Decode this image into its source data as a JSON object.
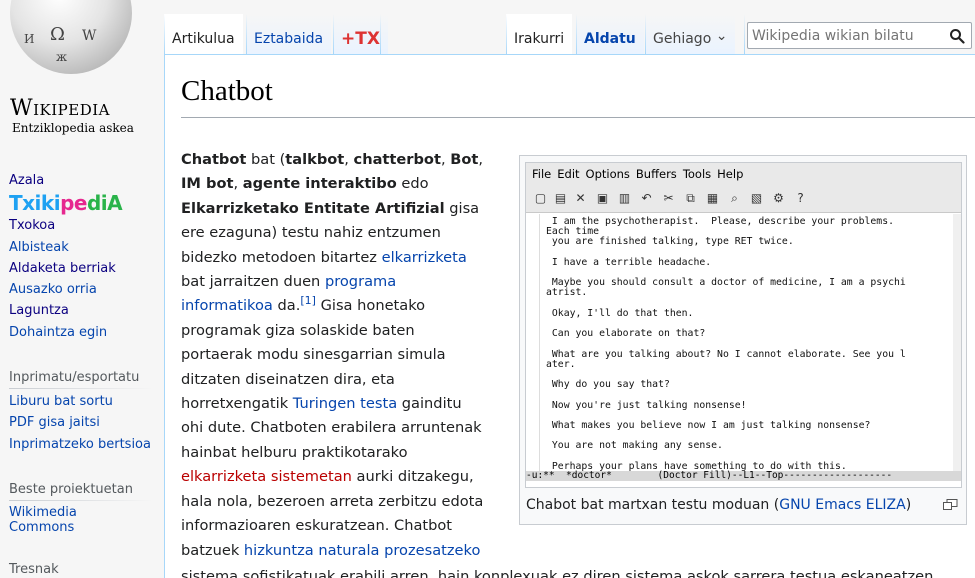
{
  "logo": {
    "wordmark": "Wikipedia",
    "tagline": "Entziklopedia askea"
  },
  "sidebar": {
    "nav": [
      {
        "label": "Azala"
      },
      {
        "label": "Txokoa"
      },
      {
        "label": "Albisteak"
      },
      {
        "label": "Aldaketa berriak"
      },
      {
        "label": "Ausazko orria"
      },
      {
        "label": "Laguntza"
      },
      {
        "label": "Dohaintza egin"
      }
    ],
    "txiki": {
      "a": "Txiki",
      "b": "pe",
      "c": "diA"
    },
    "print_heading": "Inprimatu/esportatu",
    "print": [
      {
        "label": "Liburu bat sortu"
      },
      {
        "label": "PDF gisa jaitsi"
      },
      {
        "label": "Inprimatzeko bertsioa"
      }
    ],
    "projects_heading": "Beste proiektuetan",
    "projects": [
      {
        "label": "Wikimedia Commons"
      }
    ],
    "tools_heading": "Tresnak"
  },
  "tabs": {
    "article": "Artikulua",
    "talk": "Eztabaida",
    "tx": "+TX",
    "read": "Irakurri",
    "edit": "Aldatu",
    "more": "Gehiago",
    "more_caret": "⌄"
  },
  "search": {
    "placeholder": "Wikipedia wikian bilatu"
  },
  "article": {
    "title": "Chatbot",
    "lines": [
      [
        {
          "t": "Chatbot",
          "b": true
        },
        {
          "t": " bat ("
        },
        {
          "t": "talkbot",
          "b": true
        },
        {
          "t": ", "
        },
        {
          "t": "chatterbot",
          "b": true
        },
        {
          "t": ", "
        },
        {
          "t": "Bot",
          "b": true
        },
        {
          "t": ","
        }
      ],
      [
        {
          "t": "IM bot",
          "b": true
        },
        {
          "t": ", "
        },
        {
          "t": "agente interaktibo",
          "b": true
        },
        {
          "t": " edo"
        }
      ],
      [
        {
          "t": "Elkarrizketako Entitate Artifizial",
          "b": true
        },
        {
          "t": " gisa"
        }
      ],
      [
        {
          "t": "ere ezaguna) testu nahiz entzumen"
        }
      ],
      [
        {
          "t": "bidezko metodoen bitartez "
        },
        {
          "t": "elkarrizketa",
          "l": true
        }
      ],
      [
        {
          "t": "bat jarraitzen duen "
        },
        {
          "t": "programa",
          "l": true
        }
      ],
      [
        {
          "t": "informatikoa",
          "l": true
        },
        {
          "t": " da."
        },
        {
          "t": "[1]",
          "sup": true
        },
        {
          "t": " Gisa honetako"
        }
      ],
      [
        {
          "t": "programak giza solaskide baten"
        }
      ],
      [
        {
          "t": "portaerak modu sinesgarrian simula"
        }
      ],
      [
        {
          "t": "ditzaten diseinatzen dira, eta"
        }
      ],
      [
        {
          "t": "horretxengatik "
        },
        {
          "t": "Turingen testa",
          "l": true
        },
        {
          "t": " gainditu"
        }
      ],
      [
        {
          "t": "ohi dute. Chatboten erabilera arruntenak"
        }
      ],
      [
        {
          "t": "hainbat helburu praktikotarako"
        }
      ],
      [
        {
          "t": "elkarrizketa sistemetan",
          "new": true
        },
        {
          "t": " aurki ditzakegu,"
        }
      ],
      [
        {
          "t": "hala nola, bezeroen arreta zerbitzu edota"
        }
      ],
      [
        {
          "t": "informazioaren eskuratzean. Chatbot"
        }
      ],
      [
        {
          "t": "batzuek "
        },
        {
          "t": "hizkuntza naturala prozesatzeko",
          "l": true
        }
      ]
    ],
    "last_line": "sistema sofistikatuak erabili arren, hain konplexuak ez diren sistema askok sarrera testua eskaneatzen"
  },
  "thumb": {
    "menu": [
      "File",
      "Edit",
      "Options",
      "Buffers",
      "Tools",
      "Help"
    ],
    "toolbar_icons": [
      "new-file-icon",
      "open-file-icon",
      "close-icon",
      "save-icon",
      "save-as-icon",
      "undo-icon",
      "cut-icon",
      "copy-icon",
      "paste-icon",
      "search-icon",
      "print-icon",
      "customize-icon",
      "help-icon"
    ],
    "buffer": [
      " I am the psychotherapist.  Please, describe your problems.",
      "Each time",
      " you are finished talking, type RET twice.",
      "",
      " I have a terrible headache.",
      "",
      " Maybe you should consult a doctor of medicine, I am a psychi",
      "atrist.",
      "",
      " Okay, I'll do that then.",
      "",
      " Can you elaborate on that?",
      "",
      " What are you talking about? No I cannot elaborate. See you l",
      "ater.",
      "",
      " Why do you say that?",
      "",
      " Now you're just talking nonsense!",
      "",
      " What makes you believe now I am just talking nonsense?",
      "",
      " You are not making any sense.",
      "",
      " Perhaps your plans have something to do with this."
    ],
    "modeline": "-u:**  *doctor*        (Doctor Fill)--L1--Top-------------------",
    "caption_prefix": "Chabot bat martxan testu moduan (",
    "caption_link": "GNU Emacs ELIZA",
    "caption_suffix": ")"
  }
}
